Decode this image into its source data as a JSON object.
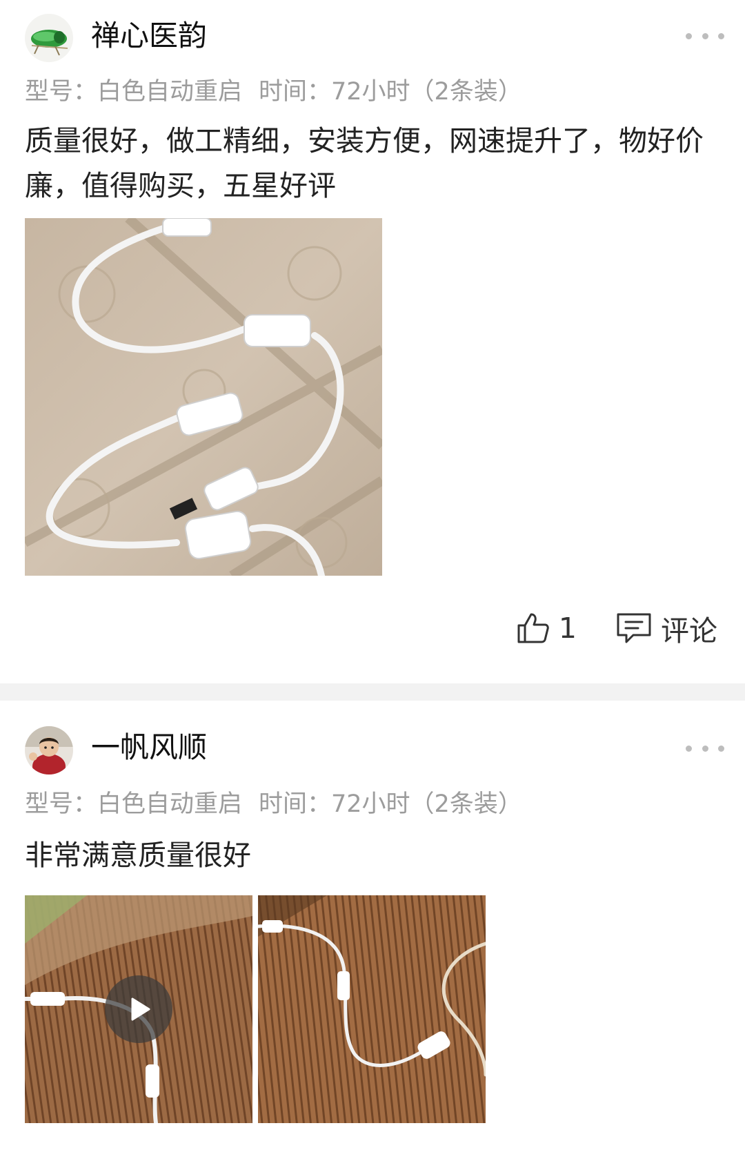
{
  "reviews": [
    {
      "user": {
        "name": "禅心医韵",
        "avatar": "cicada-avatar"
      },
      "spec": {
        "model": "型号：白色自动重启",
        "time": "时间：72小时（2条装）"
      },
      "text": "质量很好，做工精细，安装方便，网速提升了，物好价廉，值得购买，五星好评",
      "photos": [
        {
          "subject": "white-dc-power-cable-photo"
        }
      ],
      "actions": {
        "like_count": "1",
        "comment_label": "评论"
      }
    },
    {
      "user": {
        "name": "一帆风顺",
        "avatar": "child-avatar"
      },
      "spec": {
        "model": "型号：白色自动重启",
        "time": "时间：72小时（2条装）"
      },
      "text": "非常满意质量很好",
      "photos": [
        {
          "subject": "cable-on-bamboo-mat-video",
          "is_video": true
        },
        {
          "subject": "cable-on-bamboo-mat-photo"
        }
      ]
    }
  ],
  "colors": {
    "secondary_text": "#9c9c9c",
    "divider": "#f2f2f2",
    "icon": "#333333"
  }
}
